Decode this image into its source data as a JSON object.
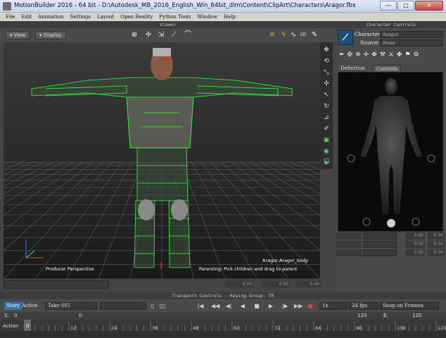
{
  "window": {
    "title": "MotionBuilder 2016   - 64 bit  - D:\\Autodesk_MB_2016_English_Win_64bit_dlm\\Content\\ClipArt\\Characters\\Aragor.fbx",
    "minimize": "—",
    "maximize": "□",
    "close": "✕"
  },
  "menu": [
    "File",
    "Edit",
    "Animation",
    "Settings",
    "Layout",
    "Open Reality",
    "Python Tools",
    "Window",
    "Help"
  ],
  "viewer": {
    "header": "Viewer",
    "view_label": "View",
    "display_label": "Display",
    "perspective_label": "Producer Perspective",
    "status_hint": "Parenting: Pick children and drag to parent",
    "selection_label": "Aragor:Aragor_body",
    "mode_2d": "2D"
  },
  "icon_strip": [
    "move-icon",
    "rotate-icon",
    "scale-icon",
    "manipulator-icon",
    "select-icon",
    "rotate-alt-icon",
    "scale-alt-icon",
    "paint-icon",
    "snap-icon",
    "camera-icon",
    "light-icon",
    "cube-icon"
  ],
  "character_controls": {
    "header": "Character Controls",
    "character_label": "Character:",
    "character_value": "Aragor",
    "source_label": "Source:",
    "source_value": "None",
    "tabs": [
      "Definition",
      "Controls"
    ],
    "active_tab": "Controls",
    "row_values": [
      "0.00",
      "0.00",
      "0.00",
      "0.00",
      "0.00",
      "0.00"
    ]
  },
  "status_values": [
    "0.00",
    "0.00",
    "0.00"
  ],
  "transport": {
    "header": "Transport Controls  -  Keying Group: TR",
    "story": "Story",
    "action": "Action",
    "take": "Take 001",
    "speed": "1x",
    "fps": "24 fps",
    "snap": "Snap on Frames",
    "range_start_label": "S:",
    "range_start": "0",
    "range_left": "0",
    "range_right": "120",
    "range_end_label": "E:",
    "range_end": "120",
    "timeline_label": "Action",
    "ticks": [
      "0",
      "12",
      "24",
      "36",
      "48",
      "60",
      "72",
      "84",
      "96",
      "108",
      "120"
    ],
    "current_frame": "0"
  },
  "colors": {
    "wireframe": "#33ff33",
    "accent": "#3a6fb0"
  }
}
